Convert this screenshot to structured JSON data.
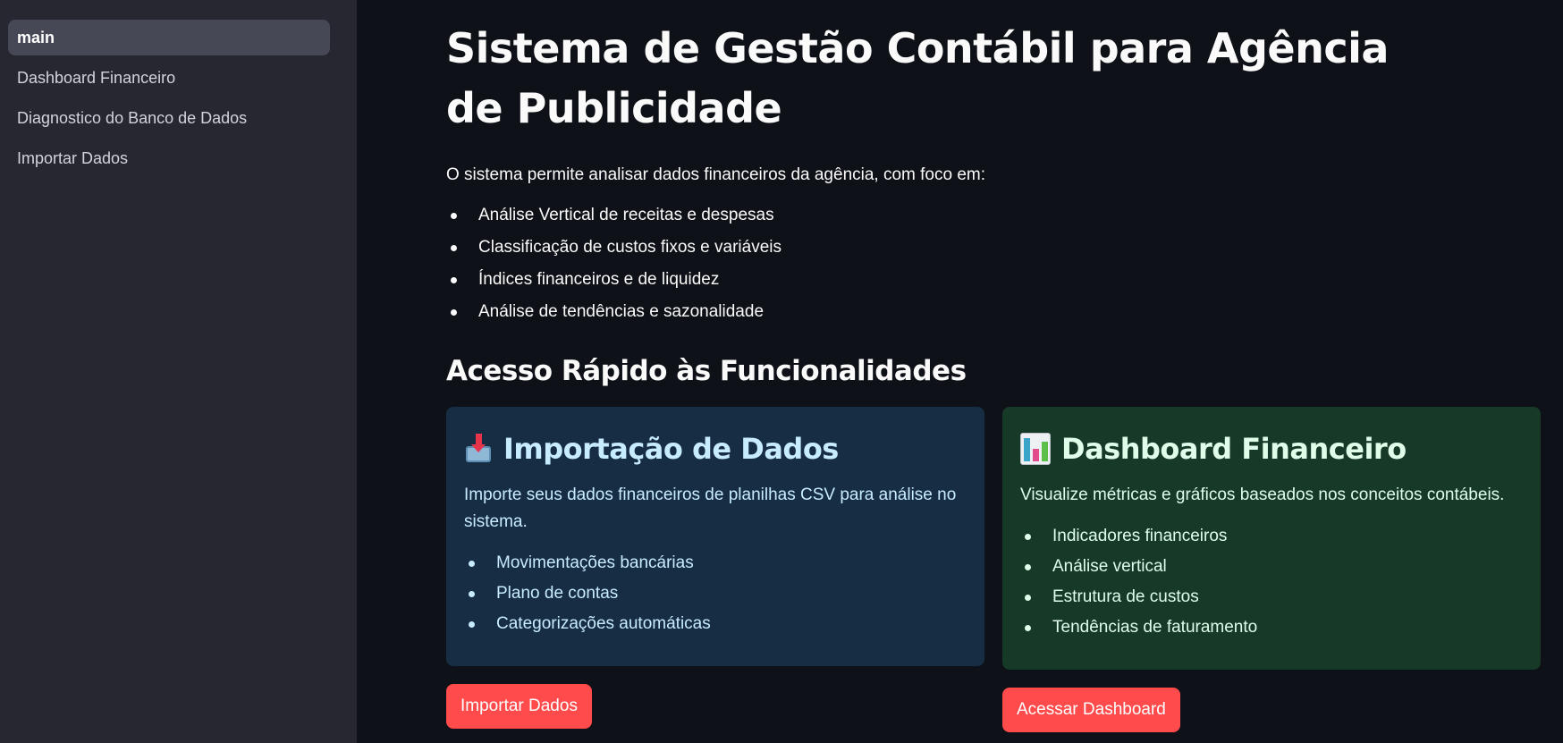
{
  "sidebar": {
    "items": [
      {
        "label": "main"
      },
      {
        "label": "Dashboard Financeiro"
      },
      {
        "label": "Diagnostico do Banco de Dados"
      },
      {
        "label": "Importar Dados"
      }
    ]
  },
  "main": {
    "title": "Sistema de Gestão Contábil para Agência de Publicidade",
    "intro": "O sistema permite analisar dados financeiros da agência, com foco em:",
    "features": [
      "Análise Vertical de receitas e despesas",
      "Classificação de custos fixos e variáveis",
      "Índices financeiros e de liquidez",
      "Análise de tendências e sazonalidade"
    ],
    "section_title": "Acesso Rápido às Funcionalidades"
  },
  "cards": {
    "import": {
      "icon": "inbox-tray-icon",
      "title": "Importação de Dados",
      "description": "Importe seus dados financeiros de planilhas CSV para análise no sistema.",
      "items": [
        "Movimentações bancárias",
        "Plano de contas",
        "Categorizações automáticas"
      ],
      "button_label": "Importar Dados",
      "color": "#172d43"
    },
    "dashboard": {
      "icon": "bar-chart-icon",
      "title": "Dashboard Financeiro",
      "description": "Visualize métricas e gráficos baseados nos conceitos contábeis.",
      "items": [
        "Indicadores financeiros",
        "Análise vertical",
        "Estrutura de custos",
        "Tendências de faturamento"
      ],
      "button_label": "Acessar Dashboard",
      "color": "#173928"
    }
  },
  "colors": {
    "background": "#0e1117",
    "sidebar": "#262730",
    "accent": "#ff4b4b"
  }
}
